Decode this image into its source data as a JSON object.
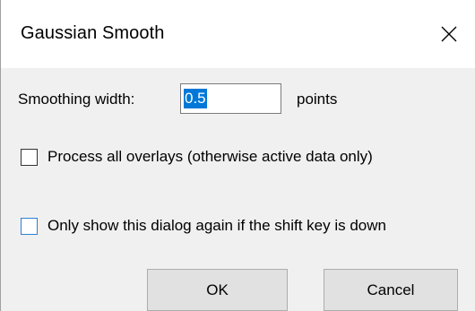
{
  "window": {
    "title": "Gaussian Smooth",
    "close_icon": "close-icon"
  },
  "smoothing": {
    "label": "Smoothing width:",
    "value": "0.5",
    "unit": "points"
  },
  "options": {
    "process_overlays": {
      "label": "Process all overlays (otherwise active data only)",
      "checked": false
    },
    "only_show_shift": {
      "label": "Only show this dialog again if the shift key is down",
      "checked": false
    }
  },
  "buttons": {
    "ok": "OK",
    "cancel": "Cancel"
  },
  "colors": {
    "selection": "#0078d7",
    "focus_border": "#2f7fd6",
    "dialog_bg": "#f0f0f0",
    "titlebar_bg": "#ffffff"
  }
}
